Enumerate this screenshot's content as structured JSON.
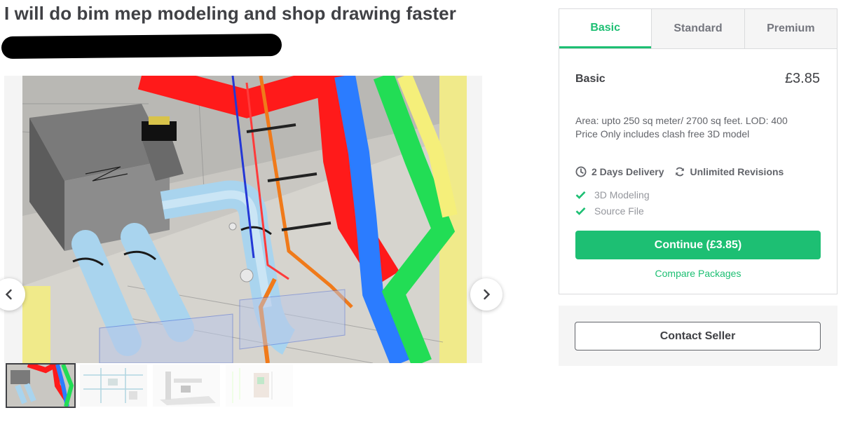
{
  "gig": {
    "title": "I will do bim mep modeling and shop drawing faster"
  },
  "gallery": {
    "prev_icon": "chevron-left-icon",
    "next_icon": "chevron-right-icon",
    "thumbnail_count": 4
  },
  "packages": {
    "tabs": [
      "Basic",
      "Standard",
      "Premium"
    ],
    "active_tab": "Basic",
    "selected": {
      "name": "Basic",
      "price": "£3.85",
      "description_line1": "Area: upto 250 sq meter/ 2700 sq feet. LOD: 400",
      "description_line2": "Price Only includes clash free 3D model",
      "delivery": "2 Days Delivery",
      "revisions": "Unlimited Revisions",
      "features": [
        "3D Modeling",
        "Source File"
      ]
    },
    "continue_label": "Continue (£3.85)",
    "compare_label": "Compare Packages"
  },
  "contact": {
    "label": "Contact Seller"
  },
  "colors": {
    "accent": "#1dbf73",
    "text": "#404145",
    "border": "#dadbdd"
  }
}
